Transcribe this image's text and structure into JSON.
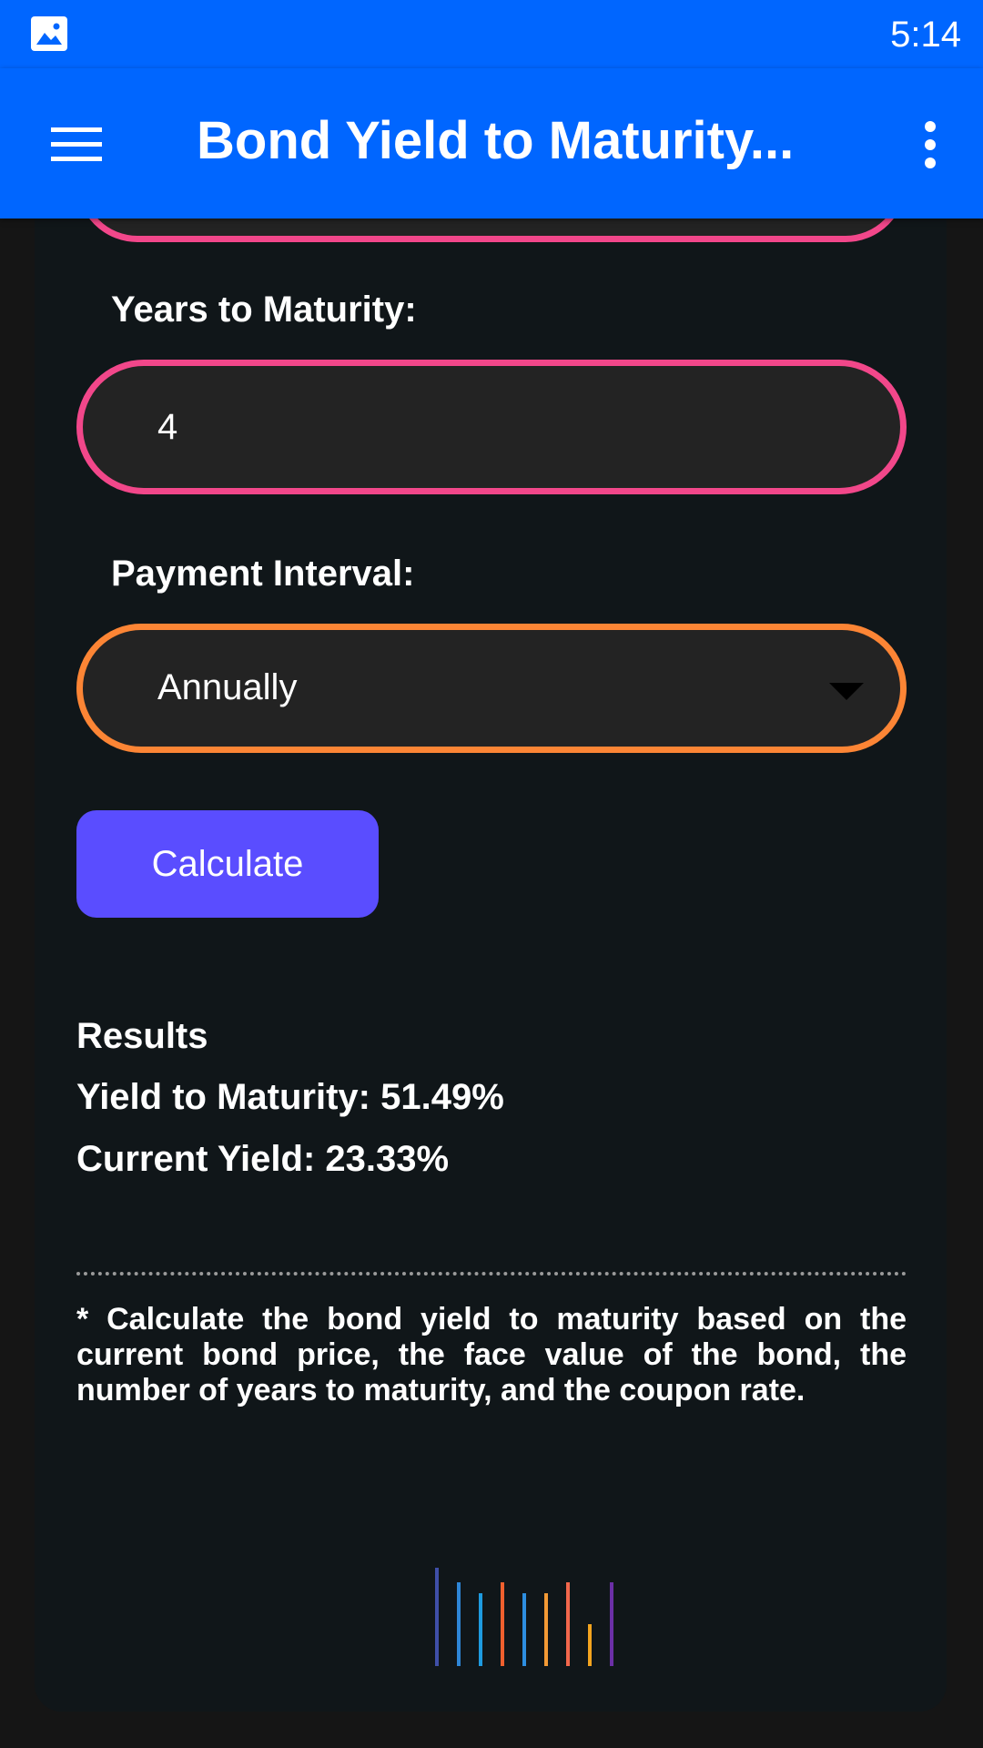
{
  "status_bar": {
    "time": "5:14",
    "image_icon": "image-icon"
  },
  "app_bar": {
    "title": "Bond Yield to Maturity...",
    "menu_icon": "hamburger-menu-icon",
    "overflow_icon": "more-vert-icon",
    "color": "#0066ff"
  },
  "form": {
    "years_label": "Years to Maturity:",
    "years_value": "4",
    "interval_label": "Payment Interval:",
    "interval_value": "Annually",
    "calculate_label": "Calculate",
    "input_border_color": "#f2478a",
    "select_border_color": "#fc8535",
    "button_color": "#5a4dff"
  },
  "results": {
    "heading": "Results",
    "ytm_label": "Yield to Maturity:",
    "ytm_value": "51.49%",
    "current_label": "Current Yield:",
    "current_value": "23.33%"
  },
  "footnote": "* Calculate the bond yield to maturity based on the current bond price, the face value of the bond, the number of years to maturity, and the coupon rate.",
  "logo": {
    "icon": "bars-logo-icon",
    "colors": [
      "#3f4fa8",
      "#2e86d6",
      "#1e9be0",
      "#f0602e",
      "#2d8ee0",
      "#f39a35",
      "#f2674c",
      "#f3a41f",
      "#6b2fa6"
    ]
  }
}
